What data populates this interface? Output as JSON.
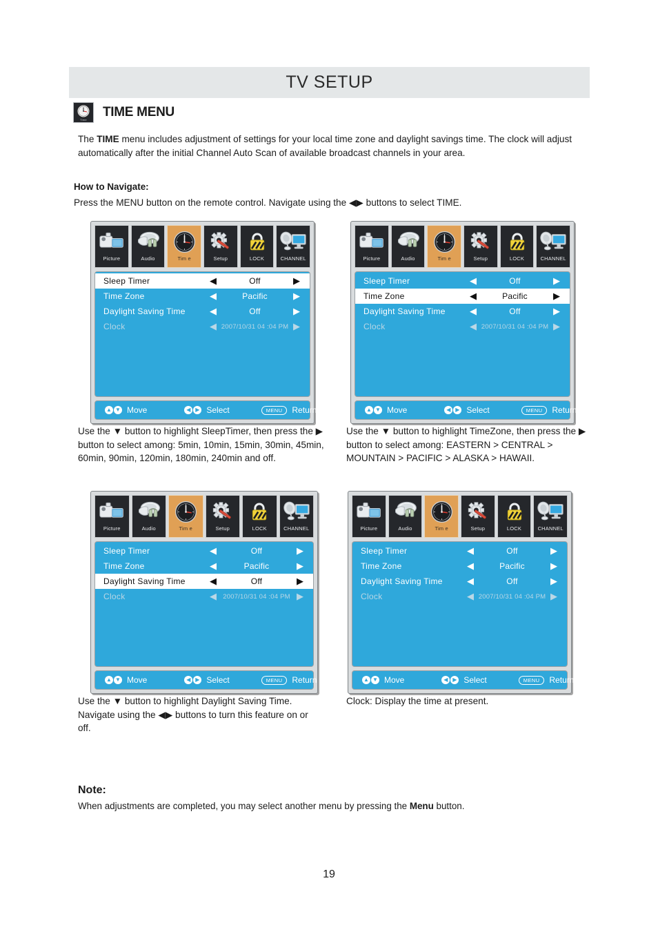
{
  "header": {
    "title": "TV SETUP"
  },
  "section": {
    "icon": "clock-icon",
    "icon_caption": "Time",
    "title": "TIME MENU"
  },
  "intro": {
    "line1_a": "The ",
    "line1_b": "TIME",
    "line1_c": " menu includes adjustment of settings for your local time zone and daylight savings time. The clock will adjust automatically after the initial Channel Auto Scan of available broadcast channels in your area."
  },
  "navigate": {
    "label": "How to Navigate:",
    "text": "Press the MENU button on the remote control. Navigate using the ◀▶ buttons to select TIME."
  },
  "osd_icons": [
    {
      "name": "picture-icon",
      "label": "Picture",
      "active": false
    },
    {
      "name": "audio-icon",
      "label": "Audio",
      "active": false
    },
    {
      "name": "clock-icon",
      "label": "Tim e",
      "active": true
    },
    {
      "name": "setup-gear-icon",
      "label": "Setup",
      "active": false
    },
    {
      "name": "lock-icon",
      "label": "LOCK",
      "active": false
    },
    {
      "name": "channel-icon",
      "label": "CHANNEL",
      "active": false
    }
  ],
  "osd_rows": [
    {
      "label": "Sleep Timer",
      "value": "Off"
    },
    {
      "label": "Time Zone",
      "value": "Pacific"
    },
    {
      "label": "Daylight  Saving Time",
      "value": "Off"
    },
    {
      "label": "Clock",
      "value": "2007/10/31 04 :04 PM"
    }
  ],
  "osd_footer": {
    "move": "Move",
    "select": "Select",
    "return": "Return",
    "menu_key": "MENU",
    "up_glyph": "▲",
    "down_glyph": "▼",
    "left_glyph": "◀",
    "right_glyph": "▶"
  },
  "panels": [
    {
      "id": "panel-sleep-timer",
      "highlight_index": 0,
      "dim_index": 3
    },
    {
      "id": "panel-time-zone",
      "highlight_index": 1,
      "dim_index": 3
    },
    {
      "id": "panel-daylight-saving",
      "highlight_index": 2,
      "dim_index": 3
    },
    {
      "id": "panel-clock",
      "highlight_index": -1,
      "dim_index": 3
    }
  ],
  "captions": {
    "sleep_timer": "Use the ▼ button to highlight SleepTimer, then press the ▶ button to select among: 5min, 10min, 15min, 30min, 45min, 60min, 90min, 120min, 180min, 240min and off.",
    "time_zone": "Use the ▼ button to highlight TimeZone, then press the ▶ button to select among: EASTERN > CENTRAL > MOUNTAIN > PACIFIC > ALASKA > HAWAII.",
    "daylight": "Use the ▼ button to highlight Daylight Saving Time. Navigate using the ◀▶ buttons to turn this feature on or off.",
    "clock": "Clock: Display the time at present."
  },
  "note": {
    "label": "Note:",
    "text_a": "When adjustments are completed, you may select another menu by pressing the ",
    "text_b": "Menu",
    "text_c": " button."
  },
  "page_number": "19",
  "colors": {
    "header_bg": "#e4e7e8",
    "osd_blue": "#2fa8db",
    "osd_active": "#e0a055",
    "osd_frame": "#d9dcde",
    "osd_tile": "#25272b"
  }
}
